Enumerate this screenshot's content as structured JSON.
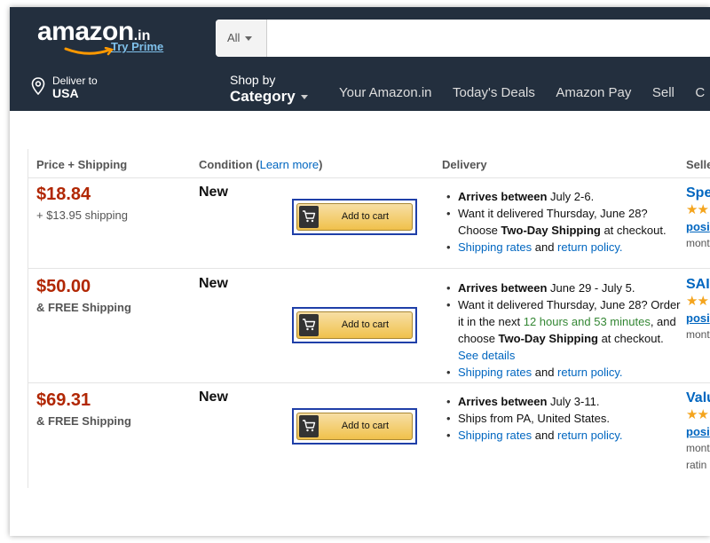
{
  "header": {
    "logo_text": "amazon",
    "logo_tld": ".in",
    "logo_prime": "Try Prime",
    "search_category": "All",
    "deliver_to_label": "Deliver to",
    "deliver_to_value": "USA",
    "shop_by_top": "Shop by",
    "shop_by_bottom": "Category",
    "nav_links": [
      "Your Amazon.in",
      "Today's Deals",
      "Amazon Pay",
      "Sell",
      "C"
    ]
  },
  "columns": {
    "price": "Price + Shipping",
    "condition": "Condition (",
    "condition_link": "Learn more",
    "condition_close": ")",
    "delivery": "Delivery",
    "seller": "Seller"
  },
  "offers": [
    {
      "price": "$18.84",
      "shipping": "+ $13.95 shipping",
      "condition": "New",
      "button": "Add to cart",
      "delivery": {
        "arrives_label": "Arrives between",
        "arrives_value": " July 2-6.",
        "want_it": "Want it delivered Thursday, June 28? Choose ",
        "two_day": "Two-Day Shipping",
        "at_checkout": " at checkout.",
        "shipping_rates": "Shipping rates",
        "and": " and ",
        "return_policy": "return policy."
      },
      "seller": {
        "name": "Spe",
        "stars": "★★",
        "link": "posi",
        "text": "mont",
        "extra": ""
      }
    },
    {
      "price": "$50.00",
      "shipping": "& FREE Shipping",
      "condition": "New",
      "button": "Add to cart",
      "delivery": {
        "arrives_label": "Arrives between",
        "arrives_value": " June 29 - July 5.",
        "want_it": "Want it delivered Thursday, June 28? Order it in the next ",
        "time": "12 hours and 53 minutes",
        "choose": ", and choose ",
        "two_day": "Two-Day Shipping",
        "at_checkout": " at checkout. ",
        "see_details": "See details",
        "shipping_rates": "Shipping rates",
        "and": " and ",
        "return_policy": "return policy."
      },
      "seller": {
        "name": "SAI",
        "stars": "★★",
        "link": "posi",
        "text": "mont",
        "extra": ""
      }
    },
    {
      "price": "$69.31",
      "shipping": "& FREE Shipping",
      "condition": "New",
      "button": "Add to cart",
      "delivery": {
        "arrives_label": "Arrives between",
        "arrives_value": " July 3-11.",
        "ships_from": "Ships from PA, United States.",
        "shipping_rates": "Shipping rates",
        "and": " and ",
        "return_policy": "return policy."
      },
      "seller": {
        "name": "Valu",
        "stars": "★★",
        "link": "posi",
        "text": "mont",
        "extra": "ratin"
      }
    }
  ],
  "colors": {
    "header_bg": "#232f3e",
    "price_red": "#b12704",
    "link_blue": "#0066c0",
    "button_gold": "#f0c14b",
    "highlight_border": "#1f3fa8",
    "time_green": "#348734"
  }
}
